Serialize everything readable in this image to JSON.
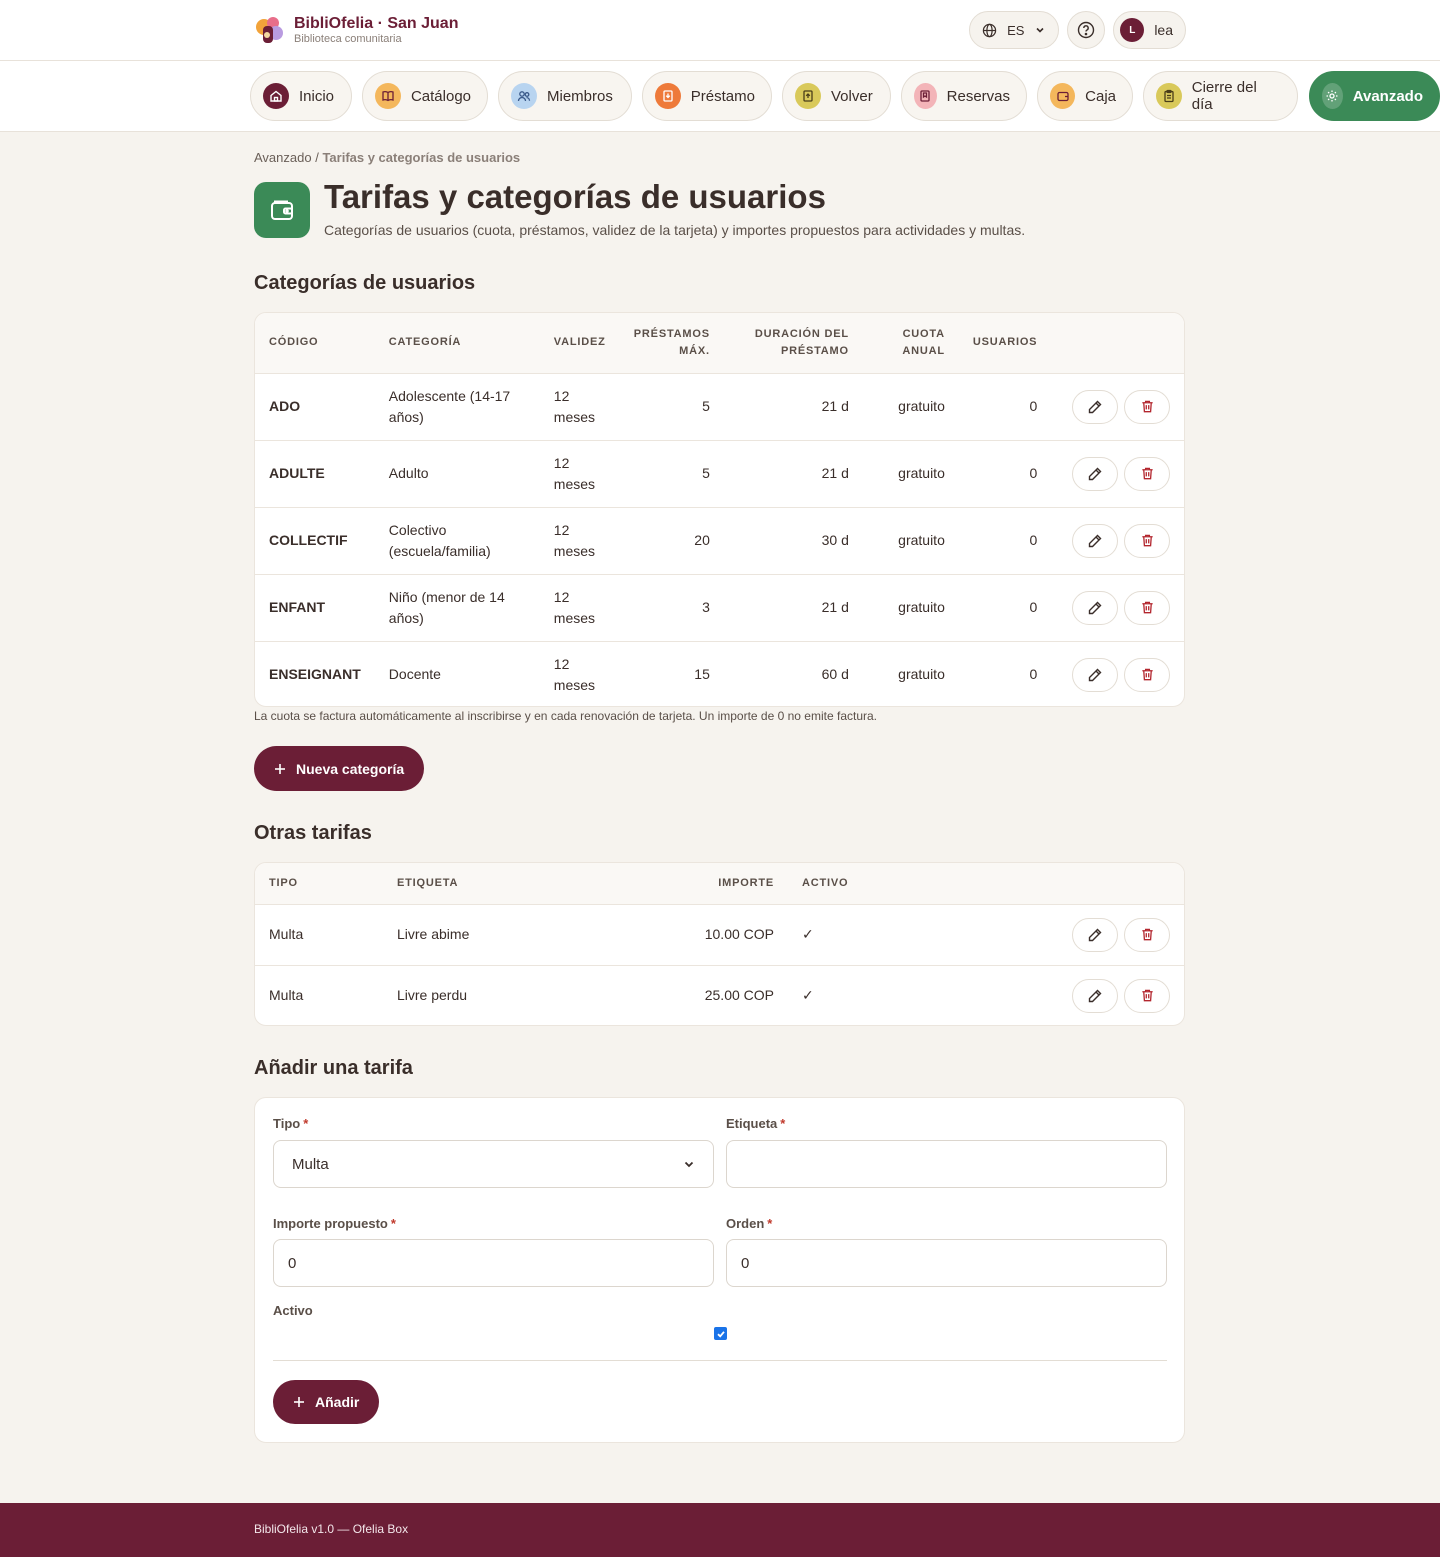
{
  "brand": {
    "name": "BibliOfelia · San Juan",
    "subtitle": "Biblioteca comunitaria"
  },
  "header": {
    "language": "ES",
    "user_initial": "L",
    "user_name": "lea"
  },
  "nav": [
    {
      "label": "Inicio",
      "icon": "home-icon"
    },
    {
      "label": "Catálogo",
      "icon": "book-icon"
    },
    {
      "label": "Miembros",
      "icon": "users-icon"
    },
    {
      "label": "Préstamo",
      "icon": "loan-icon"
    },
    {
      "label": "Volver",
      "icon": "return-icon"
    },
    {
      "label": "Reservas",
      "icon": "bookmark-icon"
    },
    {
      "label": "Caja",
      "icon": "wallet-icon"
    },
    {
      "label": "Cierre del día",
      "icon": "clipboard-icon"
    },
    {
      "label": "Avanzado",
      "icon": "gear-icon",
      "active": true
    }
  ],
  "breadcrumb": {
    "parent": "Avanzado",
    "separator": " / ",
    "current": "Tarifas y categorías de usuarios"
  },
  "page": {
    "title": "Tarifas y categorías de usuarios",
    "subtitle": "Categorías de usuarios (cuota, préstamos, validez de la tarjeta) y importes propuestos para actividades y multas."
  },
  "categories": {
    "section_title": "Categorías de usuarios",
    "headers": {
      "code": "CÓDIGO",
      "category": "CATEGORÍA",
      "validity": "VALIDEZ",
      "max_loans_1": "PRÉSTAMOS",
      "max_loans_2": "MÁX.",
      "duration_1": "DURACIÓN DEL",
      "duration_2": "PRÉSTAMO",
      "fee_1": "CUOTA",
      "fee_2": "ANUAL",
      "users": "USUARIOS"
    },
    "rows": [
      {
        "code": "ADO",
        "category": "Adolescente (14-17 años)",
        "validity": "12 meses",
        "max_loans": "5",
        "duration": "21 d",
        "fee": "gratuito",
        "users": "0"
      },
      {
        "code": "ADULTE",
        "category": "Adulto",
        "validity": "12 meses",
        "max_loans": "5",
        "duration": "21 d",
        "fee": "gratuito",
        "users": "0"
      },
      {
        "code": "COLLECTIF",
        "category": "Colectivo (escuela/familia)",
        "validity": "12 meses",
        "max_loans": "20",
        "duration": "30 d",
        "fee": "gratuito",
        "users": "0"
      },
      {
        "code": "ENFANT",
        "category": "Niño (menor de 14 años)",
        "validity": "12 meses",
        "max_loans": "3",
        "duration": "21 d",
        "fee": "gratuito",
        "users": "0"
      },
      {
        "code": "ENSEIGNANT",
        "category": "Docente",
        "validity": "12 meses",
        "max_loans": "15",
        "duration": "60 d",
        "fee": "gratuito",
        "users": "0"
      }
    ],
    "note": "La cuota se factura automáticamente al inscribirse y en cada renovación de tarjeta. Un importe de 0 no emite factura.",
    "new_button": "Nueva categoría"
  },
  "fees": {
    "section_title": "Otras tarifas",
    "headers": {
      "type": "TIPO",
      "label": "ETIQUETA",
      "amount": "IMPORTE",
      "active": "ACTIVO"
    },
    "rows": [
      {
        "type": "Multa",
        "label": "Livre abime",
        "amount": "10.00 COP",
        "active": "✓"
      },
      {
        "type": "Multa",
        "label": "Livre perdu",
        "amount": "25.00 COP",
        "active": "✓"
      }
    ]
  },
  "add_fee": {
    "section_title": "Añadir una tarifa",
    "type_label": "Tipo",
    "type_value": "Multa",
    "label_label": "Etiqueta",
    "label_value": "",
    "amount_label": "Importe propuesto",
    "amount_value": "0",
    "order_label": "Orden",
    "order_value": "0",
    "active_label": "Activo",
    "active_checked": true,
    "required_mark": "*",
    "submit": "Añadir"
  },
  "footer": {
    "text": "BibliOfelia v1.0 — Ofelia Box"
  },
  "colors": {
    "brand": "#6b1e36",
    "accent_green": "#3b8a57",
    "background": "#f6f3ee",
    "danger": "#b3262e"
  }
}
